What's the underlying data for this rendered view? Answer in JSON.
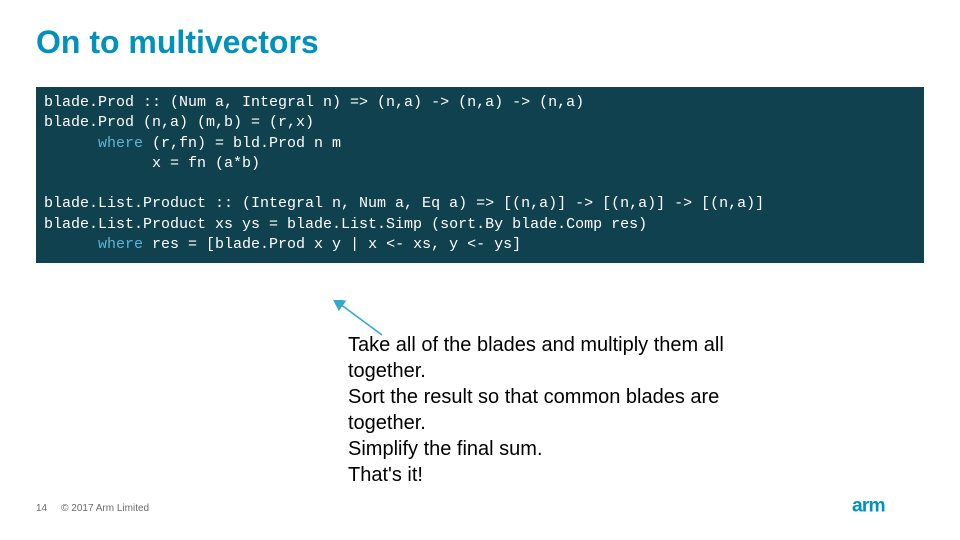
{
  "title": "On to multivectors",
  "code": {
    "l1_a": "blade.Prod :: (Num a, Integral n) => (n,a) -> (n,a) -> (n,a)",
    "l2_a": "blade.Prod (n,a) (m,b) = (r,x)",
    "l3_kw": "      where ",
    "l3_a": "(r,fn) = bld.Prod n m",
    "l4_a": "            x = fn (a*b)",
    "blank": "",
    "l5_a": "blade.List.Product :: (Integral n, Num a, Eq a) => [(n,a)] -> [(n,a)] -> [(n,a)]",
    "l6_a": "blade.List.Product xs ys = blade.List.Simp (sort.By blade.Comp res)",
    "l7_kw": "      where ",
    "l7_a": "res = [blade.Prod x y | x <- xs, y <- ys]"
  },
  "annotation": {
    "p1": "Take all of the blades and multiply them all together.",
    "p2": "Sort the result so that common blades are together.",
    "p3": "Simplify the final sum.",
    "p4": "That's it!"
  },
  "footer": {
    "page": "14",
    "copyright": "© 2017 Arm Limited"
  },
  "logo_text": "arm",
  "colors": {
    "accent": "#0091bd",
    "code_bg": "#10414f"
  }
}
